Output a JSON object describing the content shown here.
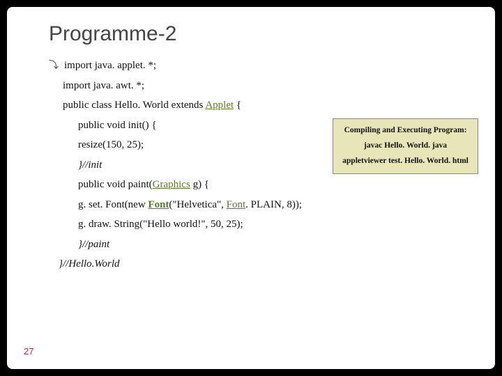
{
  "title": "Programme-2",
  "code": {
    "l1": "import java. applet. *;",
    "l2": "import java. awt. *;",
    "l3a": "public class Hello. World extends ",
    "l3b": "Applet",
    "l3c": " {",
    "l4": "public void init() {",
    "l5": "resize(150, 25);",
    "l6": "}//init",
    "l7a": "public void paint(",
    "l7b": "Graphics",
    "l7c": " g) {",
    "l8a": "g. set. Font(new ",
    "l8b": "Font",
    "l8c": "(\"Helvetica\", ",
    "l8d": "Font",
    "l8e": ". PLAIN, 8));",
    "l9": "g. draw. String(\"Hello world!\", 50, 25);",
    "l10": "}//paint",
    "l11": "}//Hello.World"
  },
  "callout": {
    "heading": "Compiling and Executing Program:",
    "line1": "javac Hello. World. java",
    "line2": "appletviewer test. Hello. World. html"
  },
  "pagenum": "27"
}
